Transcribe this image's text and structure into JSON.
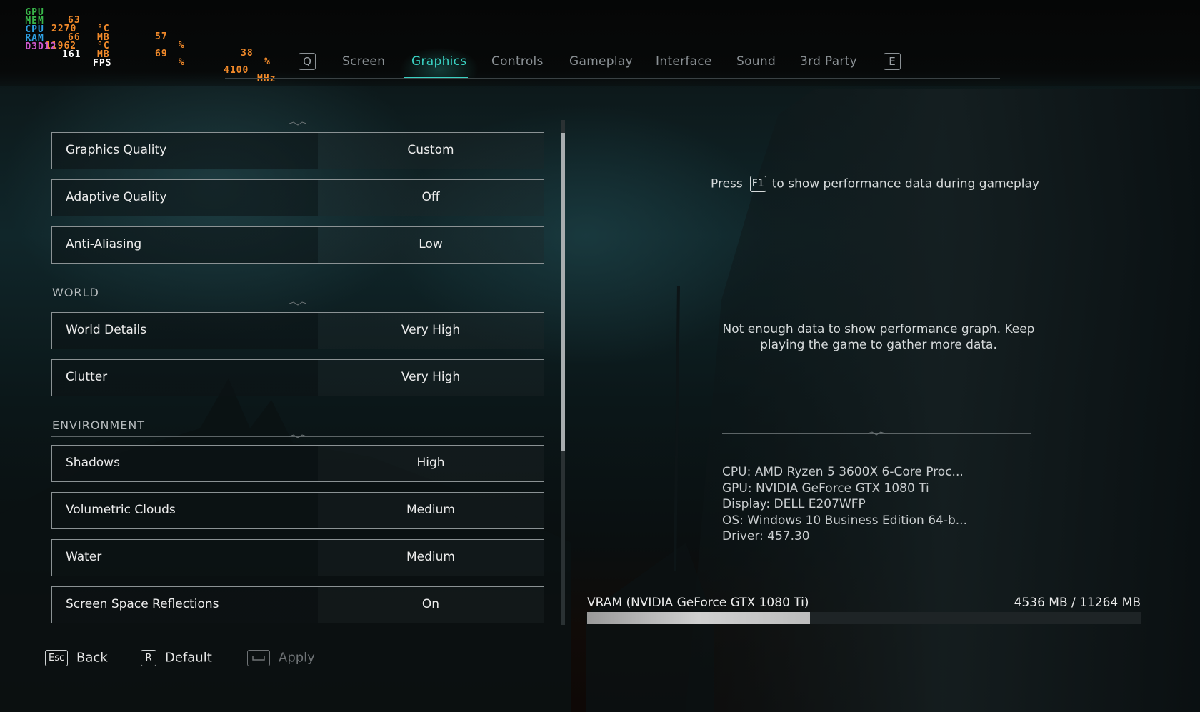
{
  "osd": {
    "rows": [
      {
        "label": "GPU",
        "label_color": "#39b54a",
        "v1": "63",
        "u1": "°C",
        "v2": "57",
        "u2": "%",
        "v3": "38",
        "u3": "%"
      },
      {
        "label": "MEM",
        "label_color": "#39b54a",
        "v1": "2270",
        "u1": "MB"
      },
      {
        "label": "CPU",
        "label_color": "#2fa2e6",
        "v1": "66",
        "u1": "°C",
        "v2": "69",
        "u2": "%",
        "v3": "4100",
        "u3": "MHz"
      },
      {
        "label": "RAM",
        "label_color": "#2fa2e6",
        "v1": "11962",
        "u1": "MB"
      },
      {
        "label": "D3D12",
        "label_color": "#d05ad0",
        "v1": "161",
        "u1": "FPS"
      }
    ]
  },
  "tabs": {
    "prev_key": "Q",
    "next_key": "E",
    "items": [
      "Screen",
      "Graphics",
      "Controls",
      "Gameplay",
      "Interface",
      "Sound",
      "3rd Party"
    ],
    "active": "Graphics",
    "accent_color": "#3ad1c2"
  },
  "settings": {
    "top_group": [
      {
        "label": "Graphics Quality",
        "value": "Custom"
      },
      {
        "label": "Adaptive Quality",
        "value": "Off"
      },
      {
        "label": "Anti-Aliasing",
        "value": "Low"
      }
    ],
    "world": {
      "title": "WORLD",
      "items": [
        {
          "label": "World Details",
          "value": "Very High"
        },
        {
          "label": "Clutter",
          "value": "Very High"
        }
      ]
    },
    "environment": {
      "title": "ENVIRONMENT",
      "items": [
        {
          "label": "Shadows",
          "value": "High"
        },
        {
          "label": "Volumetric Clouds",
          "value": "Medium"
        },
        {
          "label": "Water",
          "value": "Medium"
        },
        {
          "label": "Screen Space Reflections",
          "value": "On"
        }
      ]
    }
  },
  "info_panel": {
    "press_prefix": "Press",
    "f1_key": "F1",
    "press_suffix": "to show performance data during gameplay",
    "perf_message_line1": "Not enough data to show performance graph. Keep",
    "perf_message_line2": "playing the game to gather more data.",
    "system": {
      "cpu": "CPU: AMD Ryzen 5 3600X 6-Core Proc...",
      "gpu": "GPU: NVIDIA GeForce GTX 1080 Ti",
      "display": "Display: DELL E207WFP",
      "os": "OS: Windows 10 Business Edition 64-b...",
      "driver": "Driver: 457.30"
    },
    "vram": {
      "label": "VRAM (NVIDIA GeForce GTX 1080 Ti)",
      "value_text": "4536 MB / 11264 MB",
      "used_mb": 4536,
      "total_mb": 11264
    }
  },
  "footer": {
    "back": {
      "key": "Esc",
      "label": "Back"
    },
    "default": {
      "key": "R",
      "label": "Default"
    },
    "apply": {
      "key": "Space",
      "label": "Apply"
    }
  }
}
